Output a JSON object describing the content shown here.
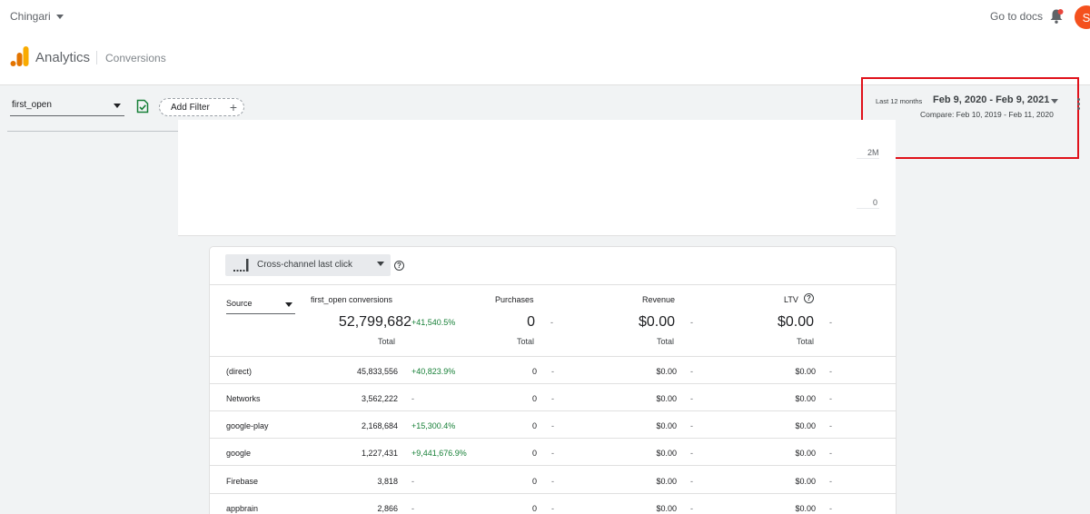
{
  "header": {
    "account": "Chingari",
    "docs_link": "Go to docs",
    "avatar_initial": "S",
    "app_title": "Analytics",
    "section": "Conversions"
  },
  "filters": {
    "event": "first_open",
    "add_filter_label": "Add Filter"
  },
  "date": {
    "preset": "Last 12 months",
    "range": "Feb 9, 2020 - Feb 9, 2021",
    "compare": "Compare: Feb 10, 2019 - Feb 11, 2020"
  },
  "chart": {
    "y_ticks": [
      "2M",
      "0"
    ]
  },
  "table": {
    "attribution": "Cross-channel last click",
    "source_label": "Source",
    "columns": [
      {
        "label": "first_open conversions",
        "total": "52,799,682",
        "change": "+41,540.5%",
        "sub": "Total"
      },
      {
        "label": "Purchases",
        "total": "0",
        "change": "-",
        "sub": "Total"
      },
      {
        "label": "Revenue",
        "total": "$0.00",
        "change": "-",
        "sub": "Total"
      },
      {
        "label": "LTV",
        "total": "$0.00",
        "change": "-",
        "sub": "Total"
      }
    ],
    "rows": [
      {
        "source": "(direct)",
        "conv": "45,833,556",
        "conv_chg": "+40,823.9%",
        "pur": "0",
        "pur_chg": "-",
        "rev": "$0.00",
        "rev_chg": "-",
        "ltv": "$0.00",
        "ltv_chg": "-"
      },
      {
        "source": "Networks",
        "conv": "3,562,222",
        "conv_chg": "-",
        "pur": "0",
        "pur_chg": "-",
        "rev": "$0.00",
        "rev_chg": "-",
        "ltv": "$0.00",
        "ltv_chg": "-"
      },
      {
        "source": "google-play",
        "conv": "2,168,684",
        "conv_chg": "+15,300.4%",
        "pur": "0",
        "pur_chg": "-",
        "rev": "$0.00",
        "rev_chg": "-",
        "ltv": "$0.00",
        "ltv_chg": "-"
      },
      {
        "source": "google",
        "conv": "1,227,431",
        "conv_chg": "+9,441,676.9%",
        "pur": "0",
        "pur_chg": "-",
        "rev": "$0.00",
        "rev_chg": "-",
        "ltv": "$0.00",
        "ltv_chg": "-"
      },
      {
        "source": "Firebase",
        "conv": "3,818",
        "conv_chg": "-",
        "pur": "0",
        "pur_chg": "-",
        "rev": "$0.00",
        "rev_chg": "-",
        "ltv": "$0.00",
        "ltv_chg": "-"
      },
      {
        "source": "appbrain",
        "conv": "2,866",
        "conv_chg": "-",
        "pur": "0",
        "pur_chg": "-",
        "rev": "$0.00",
        "rev_chg": "-",
        "ltv": "$0.00",
        "ltv_chg": "-"
      }
    ]
  },
  "icons": {
    "logo": "analytics-logo-icon",
    "bell": "notification-bell-icon",
    "check": "saved-check-icon",
    "attribution": "bar-chart-icon",
    "help": "help-icon",
    "menu": "more-vert-icon"
  },
  "colors": {
    "accent_orange": "#f9ab00",
    "avatar": "#f4511e",
    "positive_change": "#188038",
    "highlight_box": "#e0111a",
    "check_icon": "#188038"
  }
}
